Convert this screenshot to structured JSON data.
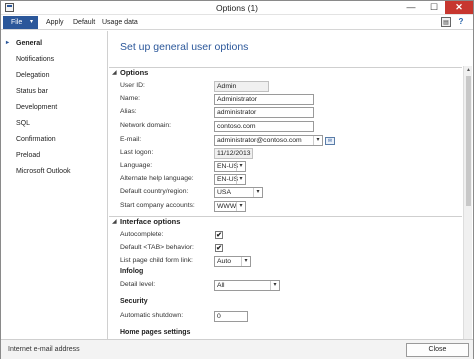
{
  "window": {
    "title": "Options (1)",
    "minimize_glyph": "—",
    "maximize_glyph": "☐",
    "close_glyph": "✕",
    "icon": "app-window-icon"
  },
  "actionbar": {
    "file_label": "File",
    "apply_label": "Apply",
    "default_label": "Default",
    "usage_label": "Usage data",
    "office_icon": "office-icon",
    "help_icon": "help-icon",
    "help_glyph": "?",
    "office_glyph": "▤"
  },
  "nav": {
    "items": [
      {
        "label": "General",
        "selected": true
      },
      {
        "label": "Notifications"
      },
      {
        "label": "Delegation"
      },
      {
        "label": "Status bar"
      },
      {
        "label": "Development"
      },
      {
        "label": "SQL"
      },
      {
        "label": "Confirmation"
      },
      {
        "label": "Preload"
      },
      {
        "label": "Microsoft Outlook"
      }
    ]
  },
  "main": {
    "title": "Set up general user options",
    "options": {
      "header": "Options",
      "user_id": {
        "label": "User ID:",
        "value": "Admin"
      },
      "name": {
        "label": "Name:",
        "value": "Administrator"
      },
      "alias": {
        "label": "Alias:",
        "value": "administrator"
      },
      "network_domain": {
        "label": "Network domain:",
        "value": "contoso.com"
      },
      "email": {
        "label": "E-mail:",
        "value": "administrator@contoso.com"
      },
      "last_logon": {
        "label": "Last logon:",
        "value": "11/12/2013"
      },
      "language": {
        "label": "Language:",
        "value": "EN-US"
      },
      "alt_help_language": {
        "label": "Alternate help language:",
        "value": "EN-US"
      },
      "default_country": {
        "label": "Default country/region:",
        "value": "USA"
      },
      "start_company": {
        "label": "Start company accounts:",
        "value": "WWW"
      }
    },
    "interface": {
      "header": "Interface options",
      "autocomplete": {
        "label": "Autocomplete:",
        "checked": true
      },
      "tab_behavior": {
        "label": "Default <TAB> behavior:",
        "checked": true
      },
      "list_page_link": {
        "label": "List page child form link:",
        "value": "Auto"
      },
      "infolog_header": "Infolog",
      "detail_level": {
        "label": "Detail level:",
        "value": "All"
      },
      "security_header": "Security",
      "auto_shutdown": {
        "label": "Automatic shutdown:",
        "value": "0"
      },
      "home_pages_header": "Home pages settings"
    },
    "check_glyph": "✔",
    "dropdown_glyph": "▾",
    "collapse_glyph": "◢"
  },
  "status": {
    "text": "Internet e-mail address",
    "close_label": "Close"
  },
  "colors": {
    "accent": "#2b579a",
    "close_red": "#c7372f"
  }
}
